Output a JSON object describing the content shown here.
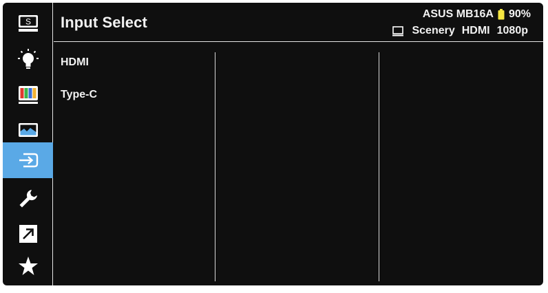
{
  "header": {
    "title": "Input Select",
    "model": "ASUS MB16A",
    "battery": "90%",
    "display_mode": "Scenery",
    "input": "HDMI",
    "resolution": "1080p"
  },
  "sidebar": {
    "items": [
      {
        "name": "splendid",
        "icon": "s-monitor-icon"
      },
      {
        "name": "blue-light-filter",
        "icon": "lightbulb-icon"
      },
      {
        "name": "color",
        "icon": "color-bars-icon"
      },
      {
        "name": "image",
        "icon": "landscape-icon"
      },
      {
        "name": "input-select",
        "icon": "input-enter-icon",
        "active": true
      },
      {
        "name": "system-setup",
        "icon": "wrench-icon"
      },
      {
        "name": "shortcut",
        "icon": "shortcut-arrow-icon"
      },
      {
        "name": "myfavorite",
        "icon": "star-icon"
      }
    ]
  },
  "options": [
    "HDMI",
    "Type-C"
  ],
  "colors": {
    "background": "#0f0f0f",
    "active": "#5aa9e6",
    "text": "#f2f2f2",
    "battery": "#f5e642"
  }
}
